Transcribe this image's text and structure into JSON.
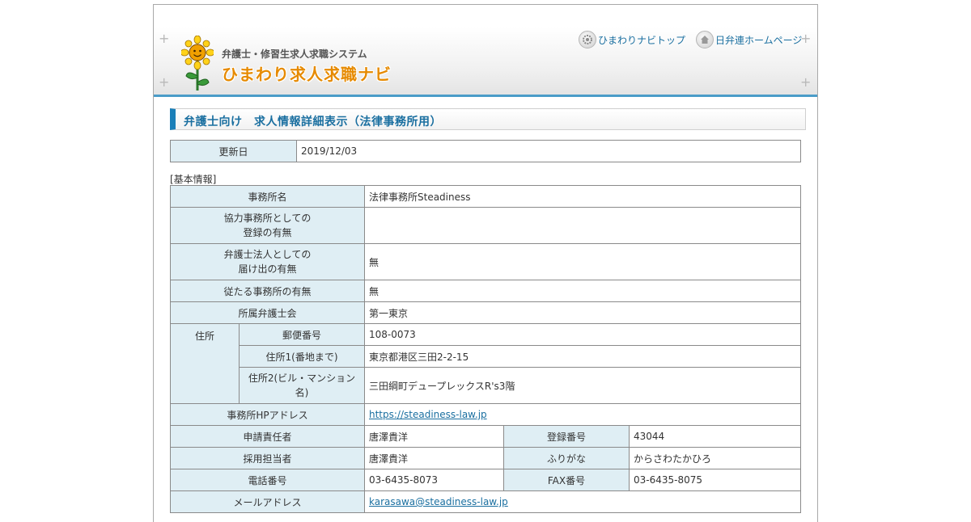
{
  "header": {
    "subtitle": "弁護士・修習生求人求職システム",
    "logo_text": "ひまわり求人求職ナビ",
    "links": {
      "navi_top": "ひまわりナビトップ",
      "nichibenren_home": "日弁連ホームページ"
    }
  },
  "page": {
    "title": "弁護士向け　求人情報詳細表示（法律事務所用）"
  },
  "update": {
    "label": "更新日",
    "value": "2019/12/03"
  },
  "basic": {
    "section_label": "[基本情報]",
    "rows": {
      "office_name": {
        "label": "事務所名",
        "value": "法律事務所Steadiness"
      },
      "cooperating": {
        "label_line1": "協力事務所としての",
        "label_line2": "登録の有無",
        "value": ""
      },
      "corporation": {
        "label_line1": "弁護士法人としての",
        "label_line2": "届け出の有無",
        "value": "無"
      },
      "subordinate": {
        "label": "従たる事務所の有無",
        "value": "無"
      },
      "bar_association": {
        "label": "所属弁護士会",
        "value": "第一東京"
      },
      "address": {
        "label": "住所",
        "postal": {
          "label": "郵便番号",
          "value": "108-0073"
        },
        "addr1": {
          "label": "住所1(番地まで)",
          "value": "東京都港区三田2-2-15"
        },
        "addr2": {
          "label": "住所2(ビル・マンション名)",
          "value": "三田綱町デュープレックスR's3階"
        }
      },
      "homepage": {
        "label": "事務所HPアドレス",
        "value": "https://steadiness-law.jp"
      },
      "applicant": {
        "label": "申請責任者",
        "value": "唐澤貴洋",
        "reg_label": "登録番号",
        "reg_value": "43044"
      },
      "recruiter": {
        "label": "採用担当者",
        "value": "唐澤貴洋",
        "kana_label": "ふりがな",
        "kana_value": "からさわたかひろ"
      },
      "phone": {
        "label": "電話番号",
        "value": "03-6435-8073",
        "fax_label": "FAX番号",
        "fax_value": "03-6435-8075"
      },
      "email": {
        "label": "メールアドレス",
        "value": "karasawa@steadiness-law.jp"
      }
    }
  },
  "colors": {
    "accent": "#1a7fb8",
    "label_bg": "#dfeef4",
    "link": "#1a6fa0",
    "logo": "#e68a00"
  },
  "icons": [
    "sunflower-logo-icon",
    "gear-icon",
    "home-icon",
    "plus-icon"
  ]
}
